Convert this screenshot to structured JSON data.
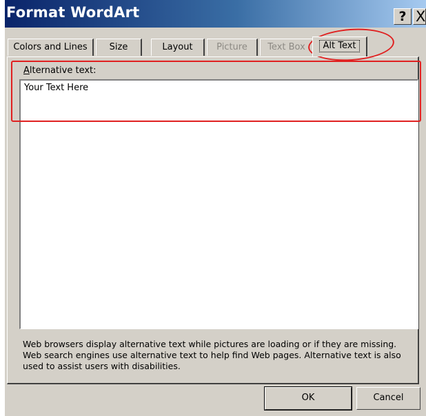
{
  "window": {
    "title": "Format WordArt",
    "help_symbol": "?",
    "close_symbol": "X"
  },
  "tabs": [
    {
      "label": "Colors and Lines",
      "state": "enabled"
    },
    {
      "label": "Size",
      "state": "enabled"
    },
    {
      "label": "Layout",
      "state": "enabled"
    },
    {
      "label": "Picture",
      "state": "disabled"
    },
    {
      "label": "Text Box",
      "state": "disabled"
    },
    {
      "label": "Alt Text",
      "state": "active"
    }
  ],
  "alt_text": {
    "label_mnemonic": "A",
    "label_rest": "lternative text:",
    "value": "Your Text Here"
  },
  "hint_text": "Web browsers display alternative text while pictures are loading or if they are missing.   Web search engines use alternative text to help find Web pages.  Alternative text is also used to assist users with disabilities.",
  "buttons": {
    "ok": "OK",
    "cancel": "Cancel"
  },
  "colors": {
    "annotation": "#e02020",
    "titlebar_start": "#0a246a",
    "dialog_bg": "#d4d0c8"
  }
}
